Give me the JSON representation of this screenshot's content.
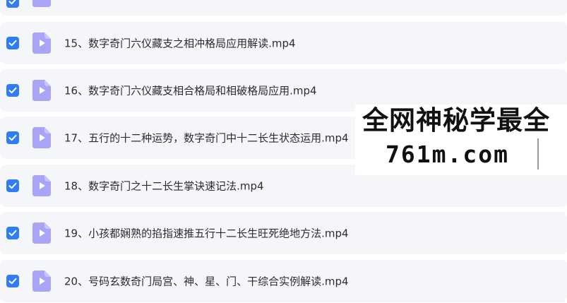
{
  "files": [
    {
      "name": "15、数字奇门六仪藏支之相冲格局应用解读.mp4",
      "checked": true
    },
    {
      "name": "16、数字奇门六仪藏支相合格局和相破格局应用.mp4",
      "checked": true
    },
    {
      "name": "17、五行的十二种运势，数字奇门中十二长生状态运用.mp4",
      "checked": true
    },
    {
      "name": "18、数字奇门之十二长生掌诀速记法.mp4",
      "checked": true
    },
    {
      "name": "19、小孩都娴熟的掐指速推五行十二长生旺死绝地方法.mp4",
      "checked": true
    },
    {
      "name": "20、号码玄数奇门局宫、神、星、门、干综合实例解读.mp4",
      "checked": true
    }
  ],
  "watermark": {
    "line1": "全网神秘学最全",
    "line2": "761m.com"
  },
  "colors": {
    "checkbox": "#2f7cf6",
    "file_icon": "#a9a4f5",
    "row_bg": "#f5f6f9"
  },
  "icons": {
    "checkbox": "check-icon",
    "file": "video-file-icon"
  }
}
